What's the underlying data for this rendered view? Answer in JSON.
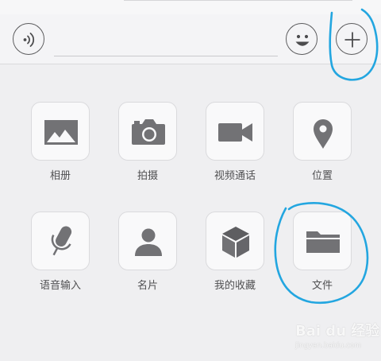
{
  "colors": {
    "background": "#efeff1",
    "icon": "#727275",
    "annotation": "#23a6e0"
  },
  "input_bar": {
    "voice_icon": "voice-icon",
    "emoji_icon": "smiley-icon",
    "plus_icon": "plus-icon"
  },
  "panel": {
    "items": [
      {
        "label": "相册",
        "icon": "image-icon"
      },
      {
        "label": "拍摄",
        "icon": "camera-icon"
      },
      {
        "label": "视频通话",
        "icon": "video-camera-icon"
      },
      {
        "label": "位置",
        "icon": "location-pin-icon"
      },
      {
        "label": "语音输入",
        "icon": "microphone-icon"
      },
      {
        "label": "名片",
        "icon": "person-icon"
      },
      {
        "label": "我的收藏",
        "icon": "cube-icon"
      },
      {
        "label": "文件",
        "icon": "folder-icon"
      }
    ]
  },
  "watermark": {
    "text": "Bai du 经验",
    "sub": "jingyan.baidu.com"
  }
}
